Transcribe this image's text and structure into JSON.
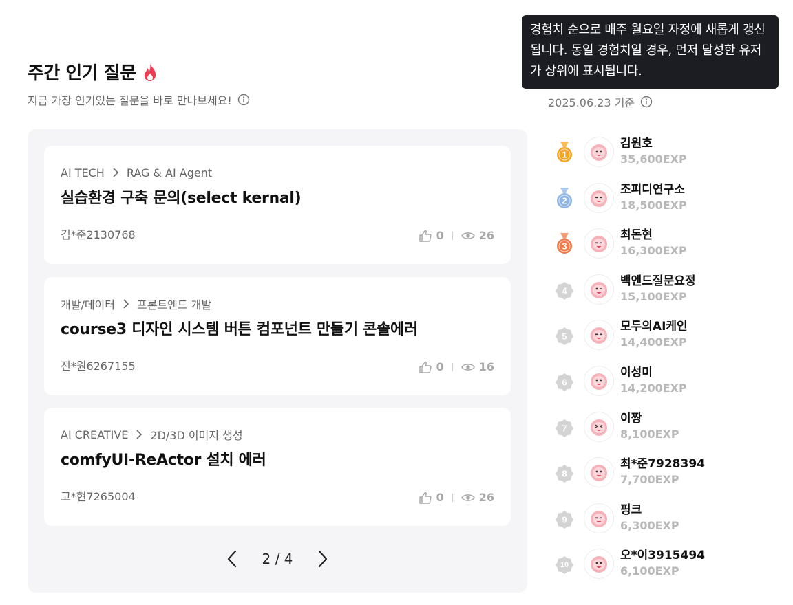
{
  "header": {
    "title": "주간 인기 질문",
    "subtitle": "지금 가장 인기있는 질문을 바로 만나보세요!"
  },
  "questions": [
    {
      "category": "AI TECH",
      "subcategory": "RAG & AI Agent",
      "title": "실습환경 구축 문의(select kernal)",
      "author": "김*준2130768",
      "likes": "0",
      "views": "26"
    },
    {
      "category": "개발/데이터",
      "subcategory": "프론트엔드 개발",
      "title": "course3 디자인 시스템 버튼 컴포넌트 만들기 콘솔에러",
      "author": "전*원6267155",
      "likes": "0",
      "views": "16"
    },
    {
      "category": "AI CREATIVE",
      "subcategory": "2D/3D 이미지 생성",
      "title": "comfyUI-ReActor 설치 에러",
      "author": "고*현7265004",
      "likes": "0",
      "views": "26"
    }
  ],
  "pagination": {
    "text": "2 / 4"
  },
  "ranking": {
    "tooltip": "경험치 순으로 매주 월요일 자정에 새롭게 갱신됩니다. 동일 경험치일 경우, 먼저 달성한 유저가 상위에 표시됩니다.",
    "basis": "2025.06.23 기준",
    "users": [
      {
        "rank": "1",
        "name": "김원호",
        "exp": "35,600EXP",
        "medal": "gold-medal",
        "face": "smile"
      },
      {
        "rank": "2",
        "name": "조피디연구소",
        "exp": "18,500EXP",
        "medal": "silver-medal",
        "face": "neutral"
      },
      {
        "rank": "3",
        "name": "최돈현",
        "exp": "16,300EXP",
        "medal": "bronze-medal",
        "face": "neutral"
      },
      {
        "rank": "4",
        "name": "백엔드질문요정",
        "exp": "15,100EXP",
        "medal": "grey-badge",
        "face": "wink"
      },
      {
        "rank": "5",
        "name": "모두의AI케인",
        "exp": "14,400EXP",
        "medal": "grey-badge",
        "face": "neutral"
      },
      {
        "rank": "6",
        "name": "이성미",
        "exp": "14,200EXP",
        "medal": "grey-badge",
        "face": "smile"
      },
      {
        "rank": "7",
        "name": "이짱",
        "exp": "8,100EXP",
        "medal": "grey-badge",
        "face": "laugh"
      },
      {
        "rank": "8",
        "name": "최*준7928394",
        "exp": "7,700EXP",
        "medal": "grey-badge",
        "face": "smile"
      },
      {
        "rank": "9",
        "name": "핑크",
        "exp": "6,300EXP",
        "medal": "grey-badge",
        "face": "neutral"
      },
      {
        "rank": "10",
        "name": "오*이3915494",
        "exp": "6,100EXP",
        "medal": "grey-badge",
        "face": "smile"
      }
    ]
  },
  "colors": {
    "gold": "#f5a524",
    "silver": "#8fb5e3",
    "bronze": "#ef7a4a",
    "grey_badge": "#d4d4d4",
    "avatar_pink": "#f5b2b8",
    "flame": "#f23a50"
  }
}
